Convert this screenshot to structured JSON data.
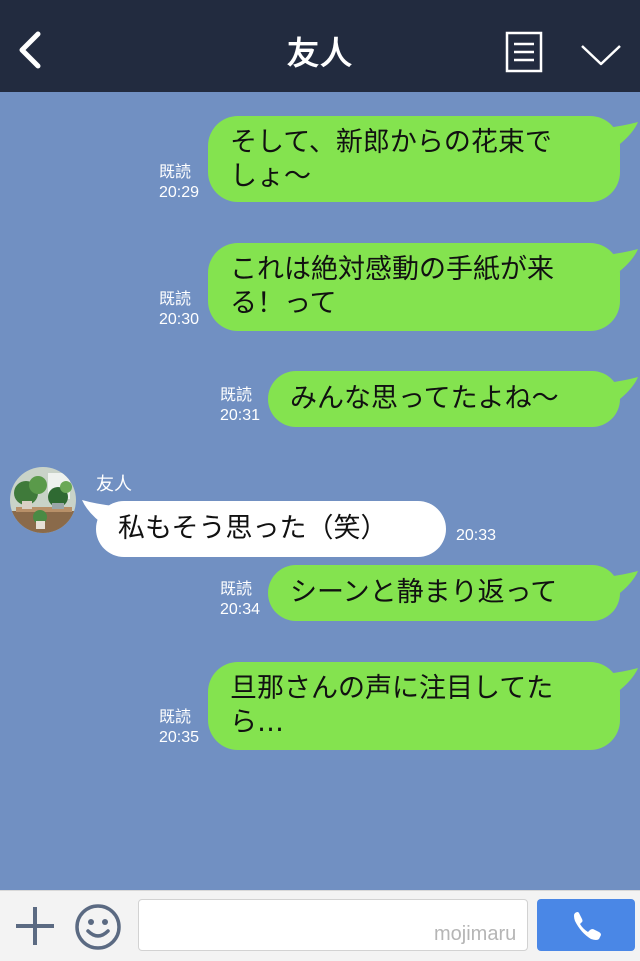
{
  "header": {
    "title": "友人"
  },
  "messages": [
    {
      "text1": "そして、新郎からの花束で",
      "text2": "しょ〜",
      "read": "既読",
      "time": "20:29"
    },
    {
      "text1": "これは絶対感動の手紙が来",
      "text2": "る！って",
      "read": "既読",
      "time": "20:30"
    },
    {
      "text1": "みんな思ってたよね〜",
      "read": "既読",
      "time": "20:31"
    },
    {
      "sender": "友人",
      "text1": "私もそう思った（笑）",
      "time": "20:33"
    },
    {
      "text1": "シーンと静まり返って",
      "read": "既読",
      "time": "20:34"
    },
    {
      "text1": "旦那さんの声に注目してた",
      "text2": "ら…",
      "read": "既読",
      "time": "20:35"
    }
  ],
  "footer": {
    "input_value": "",
    "watermark": "mojimaru"
  },
  "colors": {
    "background": "#7190c2",
    "header": "#222b3f",
    "my_bubble": "#84e34f",
    "their_bubble": "#ffffff",
    "call_button": "#4a87e6"
  },
  "icons": [
    "back-arrow-icon",
    "menu-icon",
    "chevron-down-icon",
    "avatar",
    "plus-icon",
    "emoji-icon",
    "phone-icon"
  ]
}
